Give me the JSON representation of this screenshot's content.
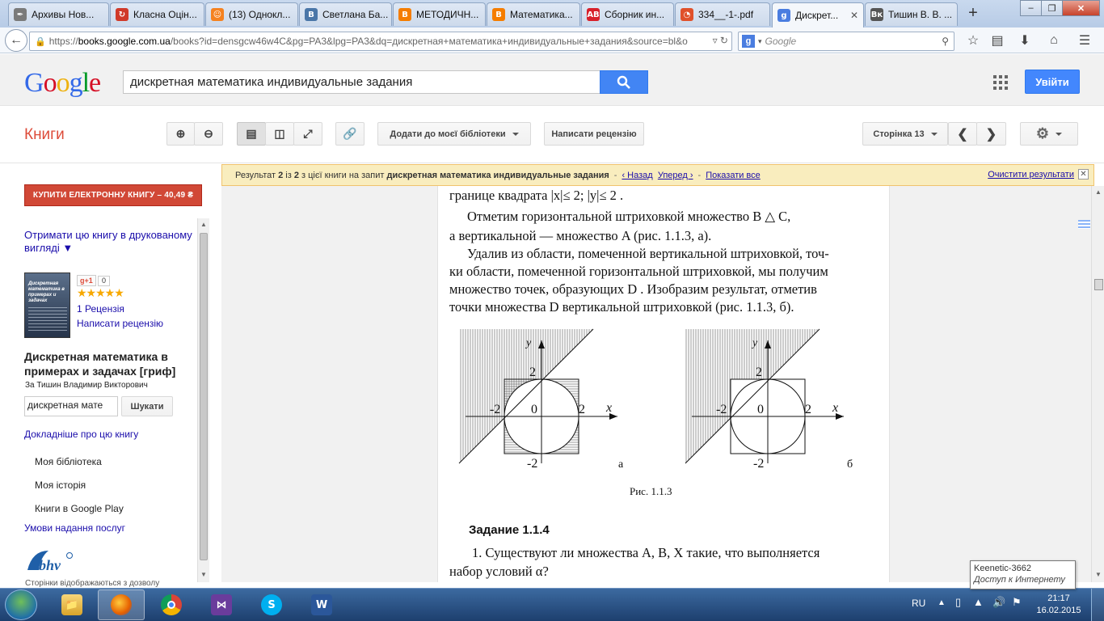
{
  "browser": {
    "tabs": [
      {
        "label": "Архивы Нов...",
        "icon": "feather-icon",
        "color": "#7a7a7a"
      },
      {
        "label": "Класна Оцін...",
        "icon": "refresh-arrow-icon",
        "color": "#d03a2a"
      },
      {
        "label": "(13) Однокл...",
        "icon": "odnoklassniki-icon",
        "color": "#f58220"
      },
      {
        "label": "Светлана Ба...",
        "icon": "vk-icon",
        "color": "#4a76a8"
      },
      {
        "label": "МЕТОДИЧН...",
        "icon": "blogger-icon",
        "color": "#f57d00"
      },
      {
        "label": "Математика...",
        "icon": "blogger-icon",
        "color": "#f57d00"
      },
      {
        "label": "Сборник ин...",
        "icon": "ab-icon",
        "color": "#d8202a"
      },
      {
        "label": "334__-1-.pdf",
        "icon": "clock-icon",
        "color": "#e0512b"
      },
      {
        "label": "Дискрет...",
        "icon": "google-g-icon",
        "color": "#4a7de0"
      },
      {
        "label": "Тишин В. В. ...",
        "icon": "vk-bw-icon",
        "color": "#555555"
      }
    ],
    "active_tab": 8,
    "url_prefix": "https://",
    "url_host": "books.google.com.ua",
    "url_rest": "/books?id=densgcw46w4C&pg=PA3&lpg=PA3&dq=дискретная+математика+индивидуальные+задания&source=bl&o",
    "search_engine_placeholder": "Google"
  },
  "google": {
    "logo": [
      "G",
      "o",
      "o",
      "g",
      "l",
      "e"
    ],
    "query": "дискретная математика индивидуальные задания",
    "signin_label": "Увійти"
  },
  "books": {
    "title": "Книги",
    "add_library": "Додати до моєї бібліотеки",
    "write_review": "Написати рецензію",
    "page_select": "Сторінка 13"
  },
  "banner": {
    "prefix": "Результат",
    "current": "2",
    "of": "із",
    "total": "2",
    "middle": "з цієї книги на запит",
    "query": "дискретная математика индивидуальные задания",
    "prev": "‹ Назад",
    "next": "Уперед ›",
    "show_all": "Показати все",
    "clear": "Очистити результати"
  },
  "sidebar": {
    "buy_label": "КУПИТИ ЕЛЕКТРОННУ КНИГУ – 40,49 ₴",
    "print_link": "Отримати цю книгу в друкованому вигляді ▼",
    "plus_label": "g+1",
    "plus_count": "0",
    "stars": "★★★★★",
    "reviews_count": "1 Рецензія",
    "write_review": "Написати рецензію",
    "cover_title": "Дискретная математика в примерах и задачах",
    "book_title": "Дискретная математика в примерах и задачах [гриф]",
    "author": "За Тишин Владимир Викторович",
    "search_value": "дискретная мате",
    "search_button": "Шукати",
    "more_about": "Докладніше про цю книгу",
    "menu": [
      "Моя бібліотека",
      "Моя історія",
      "Книги в Google Play"
    ],
    "terms": "Умови надання послуг",
    "publisher_logo": "bhv",
    "footer": "Сторінки відображаються з дозволу"
  },
  "page": {
    "line1": "границе квадрата |x|≤ 2;   |y|≤ 2 .",
    "line2": "Отметим горизонтальной штриховкой множество  B △ C,",
    "line3": "а вертикальной — множество  A  (рис. 1.1.3, а).",
    "line4": "Удалив из области, помеченной вертикальной штриховкой, точ-",
    "line5": "ки области, помеченной горизонтальной штриховкой, мы получим",
    "line6": "множество точек, образующих  D . Изобразим результат, отметив",
    "line7": "точки множества  D  вертикальной штриховкой (рис. 1.1.3, б).",
    "figure": {
      "axis_y": "y",
      "axis_x": "x",
      "tick_top": "2",
      "tick_left": "-2",
      "origin": "0",
      "tick_right": "2",
      "tick_bottom": "-2",
      "label_a": "а",
      "label_b": "б",
      "caption": "Рис. 1.1.3"
    },
    "task_heading": "Задание 1.1.4",
    "task_line1": "1. Существуют ли множества  A, B, X  такие, что выполняется",
    "task_line2": "набор условий α?"
  },
  "tray": {
    "lang": "RU",
    "time": "21:17",
    "date": "16.02.2015",
    "notif_title": "Keenetic-3662",
    "notif_sub": "Доступ к Интернету"
  }
}
